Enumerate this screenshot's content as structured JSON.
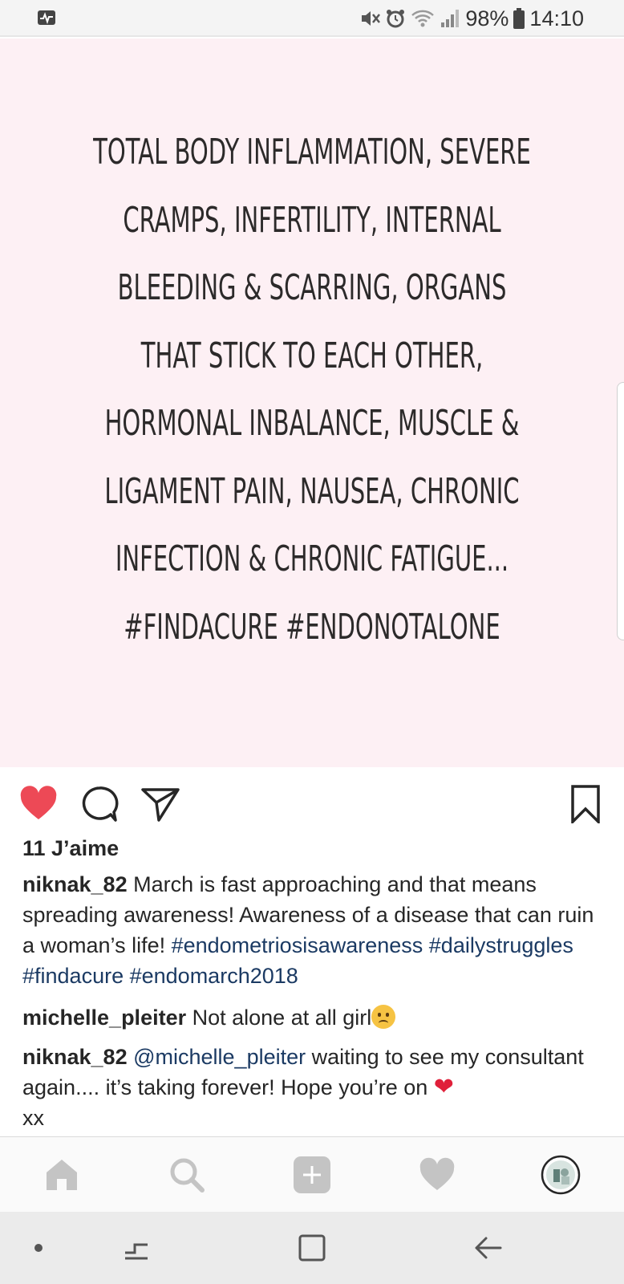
{
  "status_bar": {
    "battery": "98%",
    "time": "14:10"
  },
  "post": {
    "image_text_lines": [
      "Total body inflammation, severe",
      "cramps, infertility, internal",
      "bleeding & scarring, organs",
      "that stick to each other,",
      "hormonal inbalance,  muscle &",
      "ligament pain, nausea, chronic",
      "infection & chronic fatigue...",
      "#findacure #endonotalone"
    ],
    "likes": "11 J’aime",
    "caption": {
      "username": "niknak_82",
      "text": " March is fast approaching and that means spreading awareness! Awareness of a disease that can ruin a woman’s life! ",
      "hashtags": [
        "#endometriosisawareness",
        "#dailystruggles",
        "#findacure",
        "#endomarch2018"
      ]
    },
    "comments": [
      {
        "username": "michelle_pleiter",
        "text": " Not alone at all girl"
      },
      {
        "username": "niknak_82",
        "mention": "@michelle_pleiter",
        "text": " waiting to see my consultant again.... it’s taking forever! Hope you’re on ",
        "tail": "xx"
      }
    ]
  },
  "colors": {
    "like_red": "#ed4956",
    "link_blue": "#1b3a63",
    "image_bg": "#fdf0f4"
  }
}
